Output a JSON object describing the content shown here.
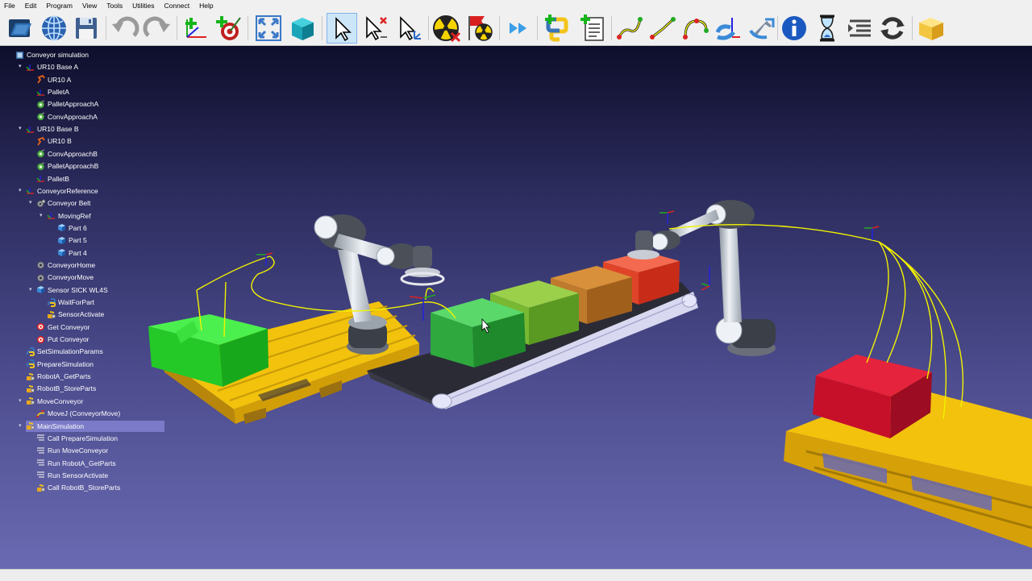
{
  "menu": [
    "File",
    "Edit",
    "Program",
    "View",
    "Tools",
    "Utilities",
    "Connect",
    "Help"
  ],
  "tree": [
    {
      "label": "Conveyor simulation",
      "icon": "station-icon",
      "indent": 0
    },
    {
      "label": "UR10 Base A",
      "icon": "reference-frame-icon",
      "indent": 1
    },
    {
      "label": "UR10 A",
      "icon": "robot-icon",
      "indent": 2
    },
    {
      "label": "PalletA",
      "icon": "reference-frame-icon",
      "indent": 2
    },
    {
      "label": "PalletApproachA",
      "icon": "target-icon",
      "indent": 2
    },
    {
      "label": "ConvApproachA",
      "icon": "target-icon",
      "indent": 2
    },
    {
      "label": "UR10 Base B",
      "icon": "reference-frame-icon",
      "indent": 1
    },
    {
      "label": "UR10 B",
      "icon": "robot-icon",
      "indent": 2
    },
    {
      "label": "ConvApproachB",
      "icon": "target-icon",
      "indent": 2
    },
    {
      "label": "PalletApproachB",
      "icon": "target-icon",
      "indent": 2
    },
    {
      "label": "PalletB",
      "icon": "reference-frame-icon",
      "indent": 2
    },
    {
      "label": "ConveyorReference",
      "icon": "reference-frame-icon",
      "indent": 1
    },
    {
      "label": "Conveyor Belt",
      "icon": "mechanism-icon",
      "indent": 2
    },
    {
      "label": "MovingRef",
      "icon": "reference-frame-icon",
      "indent": 3
    },
    {
      "label": "Part 6",
      "icon": "object-icon",
      "indent": 4
    },
    {
      "label": "Part 5",
      "icon": "object-icon",
      "indent": 4
    },
    {
      "label": "Part 4",
      "icon": "object-icon",
      "indent": 4
    },
    {
      "label": "ConveyorHome",
      "icon": "gear-target-icon",
      "indent": 2
    },
    {
      "label": "ConveyorMove",
      "icon": "gear-target-icon",
      "indent": 2
    },
    {
      "label": "Sensor SICK WL4S",
      "icon": "object-icon",
      "indent": 2
    },
    {
      "label": "WaitForPart",
      "icon": "python-icon",
      "indent": 3
    },
    {
      "label": "SensorActivate",
      "icon": "program-icon",
      "indent": 3
    },
    {
      "label": "Get Conveyor",
      "icon": "bullseye-icon",
      "indent": 2
    },
    {
      "label": "Put Conveyor",
      "icon": "bullseye-icon",
      "indent": 2
    },
    {
      "label": "SetSimulationParams",
      "icon": "python-icon",
      "indent": 1
    },
    {
      "label": "PrepareSimulation",
      "icon": "python-icon",
      "indent": 1
    },
    {
      "label": "RobotA_GetParts",
      "icon": "program-icon",
      "indent": 1
    },
    {
      "label": "RobotB_StoreParts",
      "icon": "program-icon",
      "indent": 1
    },
    {
      "label": "MoveConveyor",
      "icon": "program-icon",
      "indent": 1
    },
    {
      "label": "MoveJ (ConveyorMove)",
      "icon": "move-instruction-icon",
      "indent": 2
    },
    {
      "label": "MainSimulation",
      "icon": "program-icon",
      "indent": 1,
      "selected": true
    },
    {
      "label": "Call PrepareSimulation",
      "icon": "instruction-icon",
      "indent": 2
    },
    {
      "label": "Run MoveConveyor",
      "icon": "instruction-icon",
      "indent": 2
    },
    {
      "label": "Run RobotA_GetParts",
      "icon": "instruction-icon",
      "indent": 2
    },
    {
      "label": "Run SensorActivate",
      "icon": "instruction-icon",
      "indent": 2
    },
    {
      "label": "Call RobotB_StoreParts",
      "icon": "program-icon",
      "indent": 2
    }
  ],
  "toolbar": [
    "open-station-icon",
    "online-library-icon",
    "save-icon",
    "undo-icon",
    "redo-icon",
    "add-reference-frame-icon",
    "add-target-icon",
    "fit-all-icon",
    "iso-view-icon",
    "select-pointer-icon",
    "select-delete-icon",
    "select-reference-icon",
    "collision-off-icon",
    "collision-check-icon",
    "fast-simulation-icon",
    "add-python-program-icon",
    "add-program-icon",
    "move-joint-instruction-icon",
    "move-linear-instruction-icon",
    "move-circular-instruction-icon",
    "set-reference-frame-instruction-icon",
    "set-tool-frame-instruction-icon",
    "info-icon",
    "pause-icon",
    "program-call-icon",
    "loop-icon",
    "box-icon"
  ],
  "colors": {
    "pallet": "#f2c20c",
    "green_box": "#27d82a",
    "red_box": "#d41532",
    "trajectory": "#f2f200",
    "selection": "#7a7ac8"
  }
}
